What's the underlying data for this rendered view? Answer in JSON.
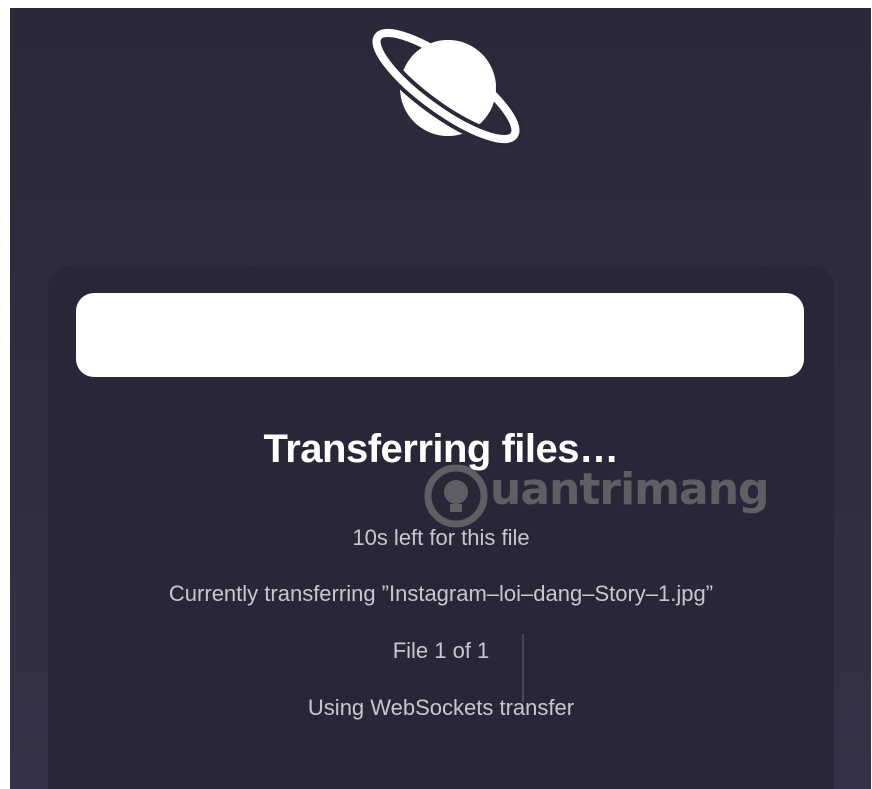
{
  "app": {
    "logo_icon": "planet-icon",
    "background_color": "#2c2839",
    "card_color": "#2a2637"
  },
  "transfer": {
    "progress_fraction": 1.0,
    "title": "Transferring files…",
    "time_left": "10s left for this file",
    "current_file": "Currently transferring ”Instagram–loi–dang–Story–1.jpg”",
    "file_count": "File 1 of 1",
    "method": "Using WebSockets transfer"
  },
  "watermark": {
    "text": "uantrimang",
    "icon": "lightbulb-icon"
  }
}
